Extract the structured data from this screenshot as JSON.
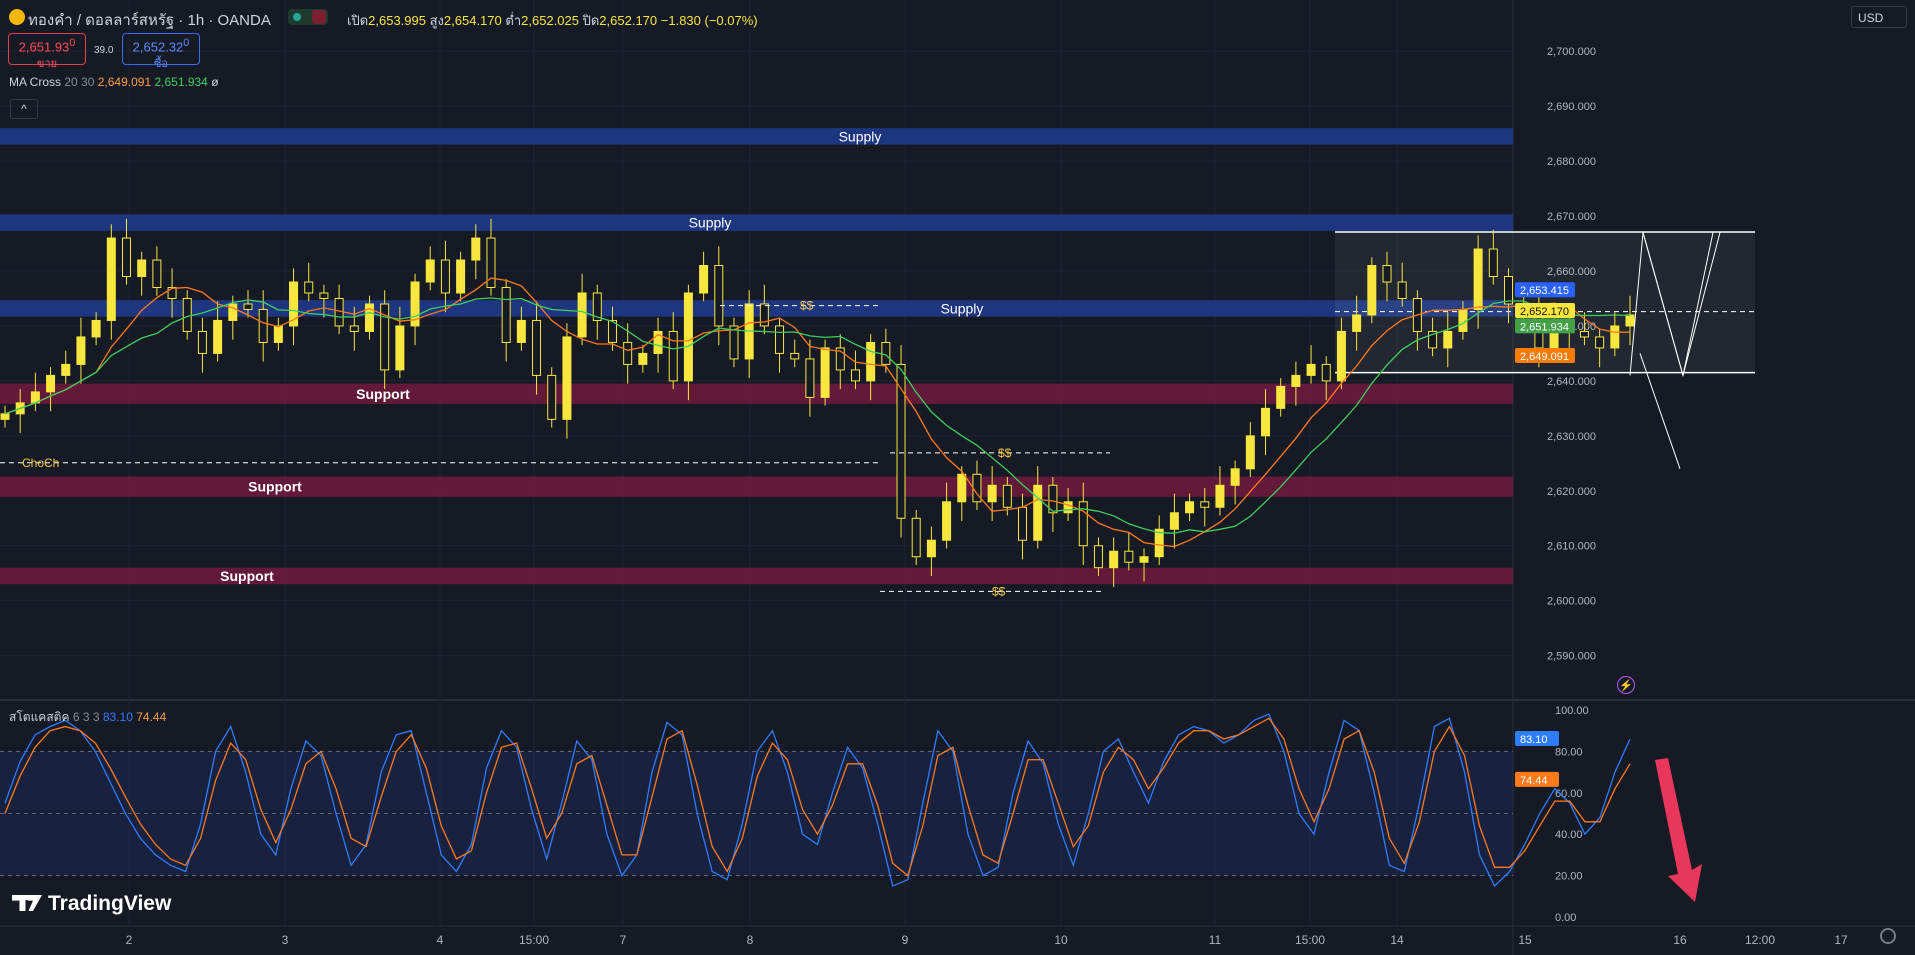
{
  "header": {
    "title": "ทองคำ / ดอลลาร์สหรัฐ · 1h · OANDA",
    "open_label": "เปิด",
    "open": "2,653.995",
    "high_label": "สูง",
    "high": "2,654.170",
    "low_label": "ต่ำ",
    "low": "2,652.025",
    "close_label": "ปิด",
    "close": "2,652.170",
    "change": "−1.830 (−0.07%)"
  },
  "trade": {
    "sell_price": "2,651.93",
    "sell_sup": "0",
    "sell_label": "ขาย",
    "spread": "39.0",
    "buy_price": "2,652.32",
    "buy_sup": "0",
    "buy_label": "ซื้อ"
  },
  "currency": "USD",
  "indicators": {
    "ma_cross": {
      "name": "MA Cross",
      "params": "20 30",
      "v1": "2,649.091",
      "v2": "2,651.934",
      "suffix": "ø"
    },
    "stoch": {
      "name": "สโตแคสติค",
      "params": "6 3 3",
      "k": "83.10",
      "d": "74.44"
    }
  },
  "brand": "TradingView",
  "colors": {
    "background": "#161a25",
    "supply_zone": "#1e3a8a",
    "support_zone": "#6b1a3c",
    "bull": "#f7e63d",
    "bear": "#f7e63d",
    "ma_fast": "#ff7a1a",
    "ma_slow": "#3fcf5e",
    "stoch_k": "#2e7cff",
    "stoch_d": "#ff7a1a",
    "price_tag": "#f7e63d",
    "arrow": "#e8375a"
  },
  "chart_data": [
    {
      "type": "candlestick",
      "title": "ทองคำ / ดอลลาร์สหรัฐ · 1h · OANDA",
      "y_ticks": [
        2590,
        2600,
        2610,
        2620,
        2630,
        2640,
        2650,
        2660,
        2670,
        2680,
        2690,
        2700
      ],
      "y_tick_labels": [
        "2,590.000",
        "2,600.000",
        "2,610.000",
        "2,620.000",
        "2,630.000",
        "2,640.000",
        "2,650.000",
        "2,660.000",
        "2,670.000",
        "2,680.000",
        "2,690.000",
        "2,700.000"
      ],
      "ylim": [
        2585.2,
        2703.5
      ],
      "x_tick_labels": [
        "2",
        "3",
        "4",
        "15:00",
        "7",
        "8",
        "9",
        "10",
        "11",
        "15:00",
        "14",
        "15",
        "16",
        "12:00",
        "17"
      ],
      "price_labels": [
        {
          "value": 2653.415,
          "text": "2,653.415",
          "color": "#2962ff"
        },
        {
          "value": 2652.17,
          "text": "2,652.170",
          "color": "#f7e63d"
        },
        {
          "value": 2651.934,
          "text": "2,651.934",
          "color": "#43a047"
        },
        {
          "value": 2649.091,
          "text": "2,649.091",
          "color": "#f57c00"
        }
      ],
      "zones": [
        {
          "label": "Supply",
          "kind": "supply",
          "from": 2683.0,
          "to": 2686.0
        },
        {
          "label": "Supply",
          "kind": "supply",
          "from": 2667.3,
          "to": 2670.3
        },
        {
          "label": "Supply",
          "kind": "supply",
          "from": 2651.7,
          "to": 2654.7
        },
        {
          "label": "Support",
          "kind": "support",
          "from": 2635.8,
          "to": 2639.5
        },
        {
          "label": "Support",
          "kind": "support",
          "from": 2618.9,
          "to": 2622.6
        },
        {
          "label": "Support",
          "kind": "support",
          "from": 2603.0,
          "to": 2606.0
        }
      ],
      "annotations": [
        {
          "text": "$$",
          "value": 2653.7
        },
        {
          "text": "$$",
          "value": 2626.9
        },
        {
          "text": "$$",
          "value": 2601.7
        },
        {
          "text": "ChoCh",
          "value": 2625.1
        }
      ],
      "range_box": {
        "high": 2667.1,
        "low": 2641.5
      },
      "candles_approx_close": [
        2634,
        2636,
        2638,
        2641,
        2643,
        2648,
        2651,
        2666,
        2659,
        2662,
        2657,
        2655,
        2649,
        2645,
        2651,
        2654,
        2653,
        2647,
        2650,
        2658,
        2656,
        2655,
        2650,
        2649,
        2654,
        2642,
        2650,
        2658,
        2662,
        2656,
        2662,
        2666,
        2657,
        2647,
        2651,
        2641,
        2633,
        2648,
        2656,
        2651,
        2647,
        2643,
        2645,
        2649,
        2640,
        2656,
        2661,
        2650,
        2644,
        2654,
        2650,
        2645,
        2644,
        2637,
        2646,
        2642,
        2640,
        2647,
        2643,
        2615,
        2608,
        2611,
        2618,
        2623,
        2618,
        2621,
        2617,
        2611,
        2621,
        2616,
        2618,
        2610,
        2606,
        2609,
        2607,
        2608,
        2613,
        2616,
        2618,
        2617,
        2621,
        2624,
        2630,
        2635,
        2639,
        2641,
        2643,
        2640,
        2649,
        2652,
        2661,
        2658,
        2655,
        2649,
        2646,
        2649,
        2653,
        2664,
        2659,
        2654,
        2652,
        2646,
        2651,
        2649,
        2648,
        2646,
        2650,
        2652
      ]
    },
    {
      "type": "line",
      "name": "สโตแคสติค 6 3 3",
      "y_ticks": [
        0,
        20,
        40,
        60,
        80,
        100
      ],
      "y_tick_labels": [
        "0.00",
        "20.00",
        "40.00",
        "60.00",
        "80.00",
        "100.00"
      ],
      "ylim": [
        0,
        100
      ],
      "series": [
        {
          "name": "83.10",
          "color": "#2e7cff",
          "values": [
            55,
            75,
            88,
            92,
            95,
            90,
            80,
            65,
            50,
            38,
            30,
            25,
            22,
            45,
            80,
            92,
            70,
            40,
            30,
            62,
            85,
            78,
            50,
            25,
            35,
            70,
            88,
            90,
            60,
            30,
            22,
            35,
            72,
            90,
            82,
            52,
            28,
            55,
            85,
            76,
            40,
            20,
            30,
            70,
            94,
            88,
            50,
            22,
            18,
            45,
            80,
            90,
            70,
            40,
            35,
            60,
            82,
            72,
            45,
            15,
            18,
            55,
            90,
            80,
            40,
            20,
            24,
            60,
            85,
            74,
            45,
            25,
            50,
            80,
            86,
            70,
            55,
            75,
            88,
            92,
            90,
            84,
            88,
            95,
            98,
            80,
            50,
            40,
            70,
            95,
            90,
            60,
            25,
            22,
            55,
            92,
            96,
            70,
            30,
            15,
            22,
            35,
            50,
            62,
            55,
            40,
            48,
            70,
            86
          ]
        },
        {
          "name": "74.44",
          "color": "#ff7a1a",
          "values": [
            50,
            68,
            82,
            90,
            92,
            90,
            84,
            72,
            58,
            45,
            35,
            28,
            25,
            38,
            66,
            84,
            76,
            52,
            36,
            52,
            74,
            80,
            62,
            38,
            34,
            58,
            80,
            88,
            72,
            44,
            28,
            32,
            60,
            82,
            84,
            62,
            38,
            50,
            74,
            78,
            54,
            30,
            30,
            58,
            86,
            90,
            64,
            34,
            22,
            38,
            68,
            84,
            76,
            52,
            40,
            54,
            74,
            74,
            54,
            26,
            20,
            44,
            78,
            82,
            54,
            30,
            26,
            50,
            76,
            76,
            55,
            34,
            44,
            70,
            82,
            76,
            62,
            72,
            84,
            90,
            90,
            86,
            88,
            92,
            96,
            86,
            62,
            46,
            62,
            86,
            90,
            70,
            38,
            26,
            46,
            80,
            92,
            78,
            44,
            24,
            24,
            32,
            44,
            56,
            56,
            46,
            46,
            62,
            74
          ]
        }
      ]
    }
  ]
}
